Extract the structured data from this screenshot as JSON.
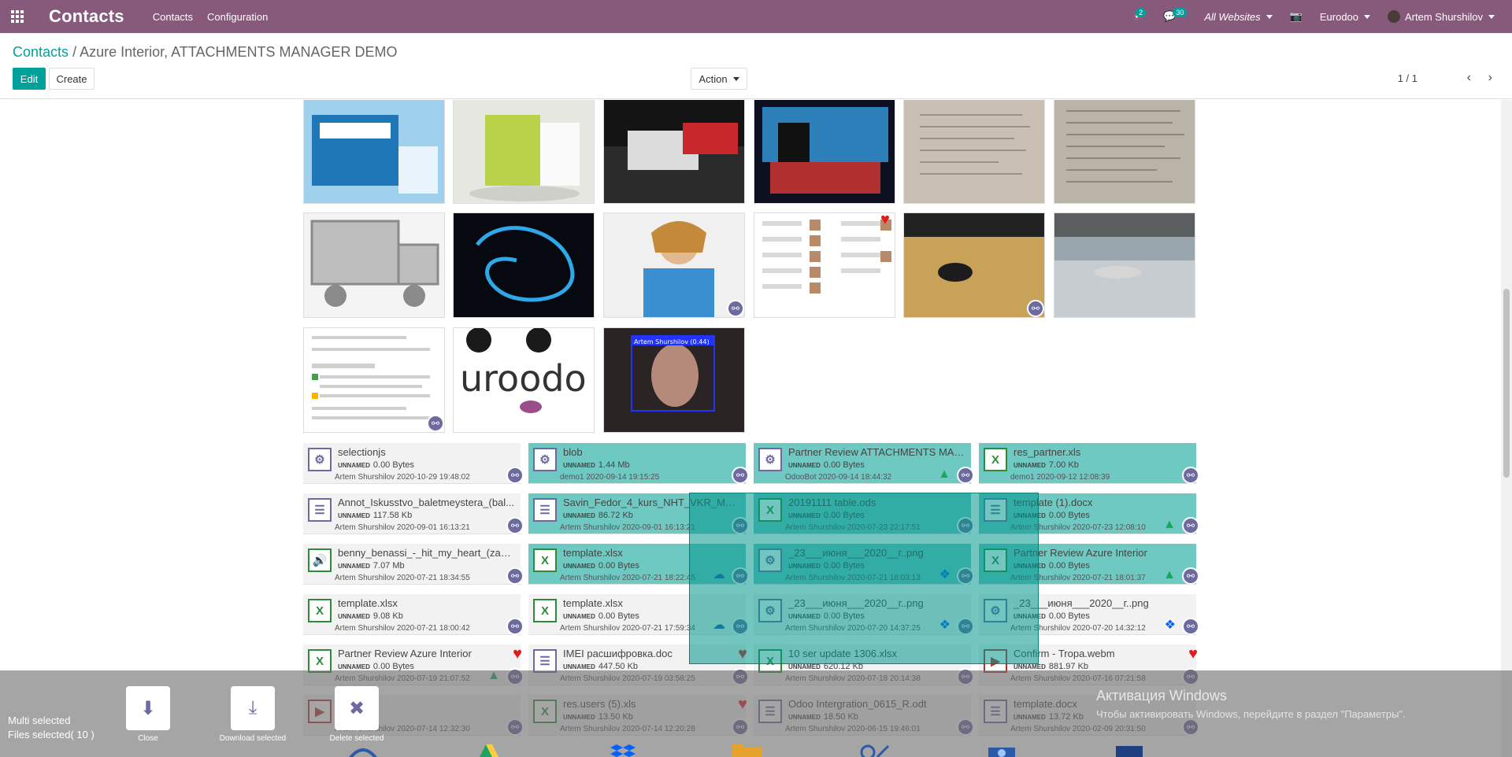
{
  "navbar": {
    "brand": "Contacts",
    "menu": [
      "Contacts",
      "Configuration"
    ],
    "activity_count": "2",
    "message_count": "30",
    "website": "All Websites",
    "company": "Eurodoo",
    "user": "Artem Shurshilov"
  },
  "breadcrumb": {
    "root": "Contacts",
    "separator": "/",
    "current": "Azure Interior, ATTACHMENTS MANAGER DEMO"
  },
  "buttons": {
    "edit": "Edit",
    "create": "Create",
    "action": "Action"
  },
  "pager": {
    "value": "1 / 1",
    "prev": "‹",
    "next": "›"
  },
  "image_labels": {
    "face_box": "Artem Shurshilov (0.44)",
    "eurodoo_logo": "uroodo"
  },
  "attachments": [
    {
      "name": "selectionjs",
      "size": "0.00 Bytes",
      "tag": "UNNAMED",
      "meta": "Artem Shurshilov 2020-10-29 19:48:02",
      "icon": "gear",
      "selected": false
    },
    {
      "name": "blob",
      "size": "1.44 Mb",
      "tag": "UNNAMED",
      "meta": "demo1 2020-09-14 19:15:25",
      "icon": "gear",
      "selected": true
    },
    {
      "name": "Partner Review ATTACHMENTS MAN...",
      "size": "0.00 Bytes",
      "tag": "UNNAMED",
      "meta": "OdooBot 2020-09-14 18:44:32",
      "icon": "gear",
      "selected": true,
      "cloud": "gdrive"
    },
    {
      "name": "res_partner.xls",
      "size": "7.00 Kb",
      "tag": "UNNAMED",
      "meta": "demo1 2020-09-12 12:08:39",
      "icon": "excel",
      "selected": true
    },
    {
      "name": "Annot_Iskusstvo_baletmeystera_(bal...",
      "size": "117.58 Kb",
      "tag": "UNNAMED",
      "meta": "Artem Shurshilov 2020-09-01 16:13:21",
      "icon": "doc",
      "selected": false
    },
    {
      "name": "Savin_Fedor_4_kurs_NHT_VKR_Meto...",
      "size": "86.72 Kb",
      "tag": "UNNAMED",
      "meta": "Artem Shurshilov 2020-09-01 16:13:21",
      "icon": "doc",
      "selected": true
    },
    {
      "name": "20191111 table.ods",
      "size": "0.00 Bytes",
      "tag": "UNNAMED",
      "meta": "Artem Shurshilov 2020-07-23 22:17:51",
      "icon": "excel",
      "selected": true
    },
    {
      "name": "template (1).docx",
      "size": "0.00 Bytes",
      "tag": "UNNAMED",
      "meta": "Artem Shurshilov 2020-07-23 12:08:10",
      "icon": "doc",
      "selected": true,
      "cloud": "gdrive"
    },
    {
      "name": "benny_benassi_-_hit_my_heart_(zayc...",
      "size": "7.07 Mb",
      "tag": "UNNAMED",
      "meta": "Artem Shurshilov 2020-07-21 18:34:55",
      "icon": "audio",
      "selected": false
    },
    {
      "name": "template.xlsx",
      "size": "0.00 Bytes",
      "tag": "UNNAMED",
      "meta": "Artem Shurshilov 2020-07-21 18:22:45",
      "icon": "excel",
      "selected": true,
      "cloud": "onedrive"
    },
    {
      "name": "_23___июня___2020__г..png",
      "size": "0.00 Bytes",
      "tag": "UNNAMED",
      "meta": "Artem Shurshilov 2020-07-21 18:03:13",
      "icon": "gear",
      "selected": true,
      "cloud": "dropbox"
    },
    {
      "name": "Partner Review Azure Interior",
      "size": "0.00 Bytes",
      "tag": "UNNAMED",
      "meta": "Artem Shurshilov 2020-07-21 18:01:37",
      "icon": "excel",
      "selected": true,
      "cloud": "gdrive"
    },
    {
      "name": "template.xlsx",
      "size": "9.08 Kb",
      "tag": "UNNAMED",
      "meta": "Artem Shurshilov 2020-07-21 18:00:42",
      "icon": "excel",
      "selected": false
    },
    {
      "name": "template.xlsx",
      "size": "0.00 Bytes",
      "tag": "UNNAMED",
      "meta": "Artem Shurshilov 2020-07-21 17:59:34",
      "icon": "excel",
      "selected": false,
      "cloud": "onedrive"
    },
    {
      "name": "_23___июня___2020__г..png",
      "size": "0.00 Bytes",
      "tag": "UNNAMED",
      "meta": "Artem Shurshilov 2020-07-20 14:37:25",
      "icon": "gear",
      "selected": false,
      "cloud": "dropbox"
    },
    {
      "name": "_23___июня___2020__г..png",
      "size": "0.00 Bytes",
      "tag": "UNNAMED",
      "meta": "Artem Shurshilov 2020-07-20 14:32:12",
      "icon": "gear",
      "selected": false,
      "cloud": "dropbox"
    },
    {
      "name": "Partner Review Azure Interior",
      "size": "0.00 Bytes",
      "tag": "UNNAMED",
      "meta": "Artem Shurshilov 2020-07-19 21:07:52",
      "icon": "excel",
      "selected": false,
      "cloud": "gdrive",
      "heart": true
    },
    {
      "name": "IMEI расшифровка.doc",
      "size": "447.50 Kb",
      "tag": "UNNAMED",
      "meta": "Artem Shurshilov 2020-07-19 03:58:25",
      "icon": "doc",
      "selected": false,
      "heart": true
    },
    {
      "name": "10 ser update 1306.xlsx",
      "size": "620.12 Kb",
      "tag": "UNNAMED",
      "meta": "Artem Shurshilov 2020-07-18 20:14:38",
      "icon": "excel",
      "selected": false
    },
    {
      "name": "Confirm - Tropa.webm",
      "size": "881.97 Kb",
      "tag": "UNNAMED",
      "meta": "Artem Shurshilov 2020-07-16 07:21:58",
      "icon": "video",
      "selected": false,
      "heart": true
    },
    {
      "name": "...o.mkv",
      "size": "...3.47 Kb",
      "tag": "",
      "meta": "Artem Shurshilov 2020-07-14 12:32:30",
      "icon": "video",
      "selected": false
    },
    {
      "name": "res.users (5).xls",
      "size": "13.50 Kb",
      "tag": "UNNAMED",
      "meta": "Artem Shurshilov 2020-07-14 12:20:28",
      "icon": "excel",
      "selected": false,
      "heart": true
    },
    {
      "name": "Odoo Intergration_0615_R.odt",
      "size": "18.50 Kb",
      "tag": "UNNAMED",
      "meta": "Artem Shurshilov 2020-06-15 19:46:01",
      "icon": "doc",
      "selected": false
    },
    {
      "name": "template.docx",
      "size": "13.72 Kb",
      "tag": "UNNAMED",
      "meta": "Artem Shurshilov 2020-02-09 20:31:50",
      "icon": "doc",
      "selected": false
    }
  ],
  "multi": {
    "label": "Multi selected",
    "count": "Files selected( 10 )",
    "close": "Close",
    "download": "Download selected",
    "delete": "Delete selected"
  },
  "windows": {
    "title": "Активация Windows",
    "subtitle": "Чтобы активировать Windows, перейдите в раздел \"Параметры\"."
  },
  "colors": {
    "navbar": "#875a7b",
    "accent": "#00a09d",
    "selected": "#6fc9c3",
    "link": "#6c6aa0",
    "heart": "#e01d1d"
  }
}
